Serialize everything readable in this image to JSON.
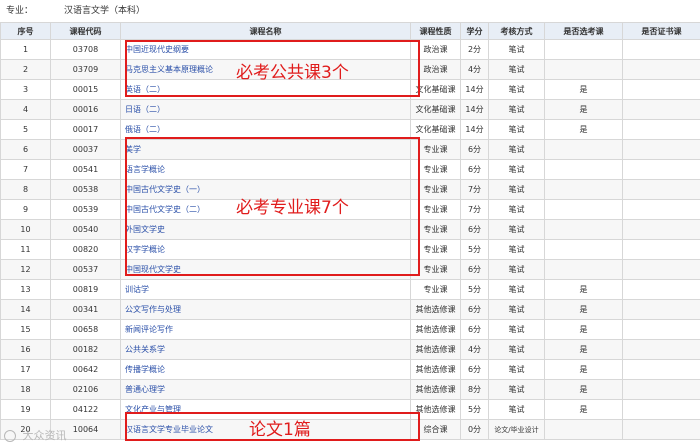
{
  "header": {
    "major_label": "专业：",
    "major_value": "汉语言文学（本科）"
  },
  "columns": [
    "序号",
    "课程代码",
    "课程名称",
    "课程性质",
    "学分",
    "考核方式",
    "是否选考课",
    "是否证书课"
  ],
  "rows": [
    {
      "no": "1",
      "code": "03708",
      "name": "中国近现代史纲要",
      "type": "政治课",
      "credit": "2分",
      "method": "笔试",
      "elective": "",
      "cert": ""
    },
    {
      "no": "2",
      "code": "03709",
      "name": "马克思主义基本原理概论",
      "type": "政治课",
      "credit": "4分",
      "method": "笔试",
      "elective": "",
      "cert": ""
    },
    {
      "no": "3",
      "code": "00015",
      "name": "英语（二）",
      "type": "文化基础课",
      "credit": "14分",
      "method": "笔试",
      "elective": "是",
      "cert": ""
    },
    {
      "no": "4",
      "code": "00016",
      "name": "日语（二）",
      "type": "文化基础课",
      "credit": "14分",
      "method": "笔试",
      "elective": "是",
      "cert": ""
    },
    {
      "no": "5",
      "code": "00017",
      "name": "俄语（二）",
      "type": "文化基础课",
      "credit": "14分",
      "method": "笔试",
      "elective": "是",
      "cert": ""
    },
    {
      "no": "6",
      "code": "00037",
      "name": "美学",
      "type": "专业课",
      "credit": "6分",
      "method": "笔试",
      "elective": "",
      "cert": ""
    },
    {
      "no": "7",
      "code": "00541",
      "name": "语言学概论",
      "type": "专业课",
      "credit": "6分",
      "method": "笔试",
      "elective": "",
      "cert": ""
    },
    {
      "no": "8",
      "code": "00538",
      "name": "中国古代文学史（一）",
      "type": "专业课",
      "credit": "7分",
      "method": "笔试",
      "elective": "",
      "cert": ""
    },
    {
      "no": "9",
      "code": "00539",
      "name": "中国古代文学史（二）",
      "type": "专业课",
      "credit": "7分",
      "method": "笔试",
      "elective": "",
      "cert": ""
    },
    {
      "no": "10",
      "code": "00540",
      "name": "外国文学史",
      "type": "专业课",
      "credit": "6分",
      "method": "笔试",
      "elective": "",
      "cert": ""
    },
    {
      "no": "11",
      "code": "00820",
      "name": "汉字学概论",
      "type": "专业课",
      "credit": "5分",
      "method": "笔试",
      "elective": "",
      "cert": ""
    },
    {
      "no": "12",
      "code": "00537",
      "name": "中国现代文学史",
      "type": "专业课",
      "credit": "6分",
      "method": "笔试",
      "elective": "",
      "cert": ""
    },
    {
      "no": "13",
      "code": "00819",
      "name": "训诂学",
      "type": "专业课",
      "credit": "5分",
      "method": "笔试",
      "elective": "是",
      "cert": ""
    },
    {
      "no": "14",
      "code": "00341",
      "name": "公文写作与处理",
      "type": "其他选修课",
      "credit": "6分",
      "method": "笔试",
      "elective": "是",
      "cert": ""
    },
    {
      "no": "15",
      "code": "00658",
      "name": "新闻评论写作",
      "type": "其他选修课",
      "credit": "6分",
      "method": "笔试",
      "elective": "是",
      "cert": ""
    },
    {
      "no": "16",
      "code": "00182",
      "name": "公共关系学",
      "type": "其他选修课",
      "credit": "4分",
      "method": "笔试",
      "elective": "是",
      "cert": ""
    },
    {
      "no": "17",
      "code": "00642",
      "name": "传播学概论",
      "type": "其他选修课",
      "credit": "6分",
      "method": "笔试",
      "elective": "是",
      "cert": ""
    },
    {
      "no": "18",
      "code": "02106",
      "name": "普通心理学",
      "type": "其他选修课",
      "credit": "8分",
      "method": "笔试",
      "elective": "是",
      "cert": ""
    },
    {
      "no": "19",
      "code": "04122",
      "name": "文化产业与管理",
      "type": "其他选修课",
      "credit": "5分",
      "method": "笔试",
      "elective": "是",
      "cert": ""
    },
    {
      "no": "20",
      "code": "10064",
      "name": "汉语言文学专业毕业论文",
      "type": "综合课",
      "credit": "0分",
      "method": "论文/毕业设计",
      "elective": "",
      "cert": ""
    }
  ],
  "annotations": {
    "public": "必考公共课3个",
    "major": "必考专业课7个",
    "thesis": "论文1篇"
  },
  "watermark": "大众资讯",
  "colors": {
    "annotation_red": "#e01c1c",
    "link_blue": "#2a4fa8",
    "header_bg": "#e8eef6"
  }
}
